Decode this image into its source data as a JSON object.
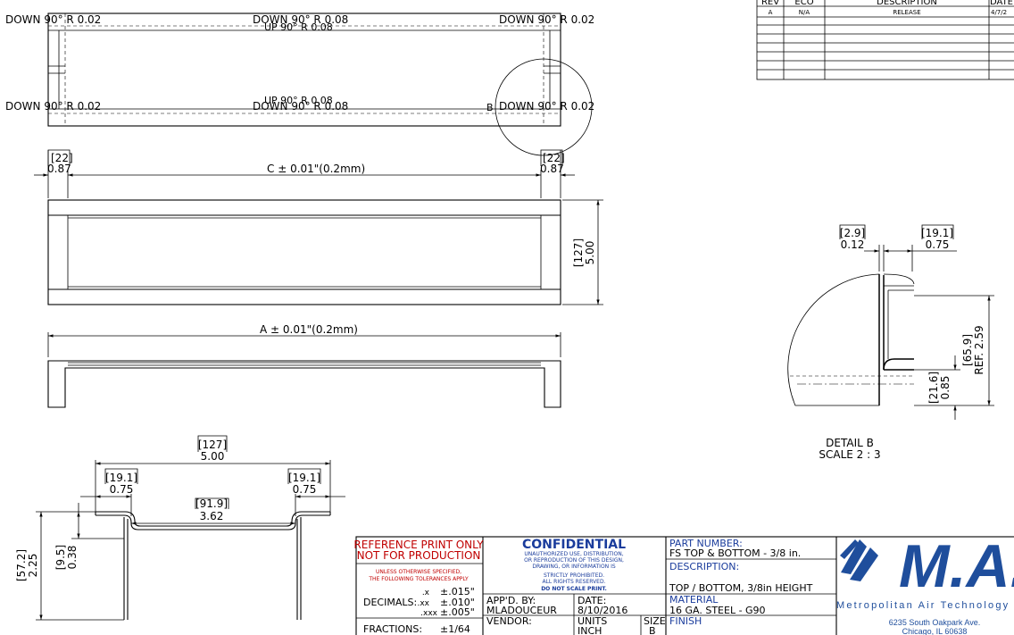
{
  "flat_pattern": {
    "bend_labels": {
      "top_left": "DOWN  90°  R 0.02",
      "top_center": "DOWN  90°  R 0.08",
      "top_center_overlap": "UP  90°  R 0.08",
      "top_right": "DOWN  90°  R 0.02",
      "bottom_left": "DOWN  90°  R 0.02",
      "bottom_center_overlap": "UP  90°  R 0.08",
      "bottom_center": "DOWN  90°  R 0.08",
      "bottom_right": "DOWN  90°  R 0.02"
    },
    "detail_marker": "B"
  },
  "top_view": {
    "left_flange_mm": "[22]",
    "left_flange_in": "0.87",
    "right_flange_mm": "[22]",
    "right_flange_in": "0.87",
    "length_dim": "C ± 0.01\"(0.2mm)",
    "width_mm": "[127]",
    "width_in": "5.00"
  },
  "front_view": {
    "length_dim": "A ± 0.01\"(0.2mm)"
  },
  "section_view": {
    "overall_mm": "[127]",
    "overall_in": "5.00",
    "left_mm": "[19.1]",
    "left_in": "0.75",
    "right_mm": "[19.1]",
    "right_in": "0.75",
    "center_mm": "[91.9]",
    "center_in": "3.62",
    "height_mm": "[57.2]",
    "height_in": "2.25",
    "lip_mm": "[9.5]",
    "lip_in": "0.38"
  },
  "detail_b": {
    "gap_mm": "[2.9]",
    "gap_in": "0.12",
    "flange_mm": "[19.1]",
    "flange_in": "0.75",
    "ref_height_mm": "[65.9]",
    "ref_height_in": "REF. 2.59",
    "low_mm": "[21.6]",
    "low_in": "0.85",
    "title": "DETAIL B",
    "scale": "SCALE 2 : 3"
  },
  "revision_table": {
    "headers": [
      "REV",
      "ECO",
      "DESCRIPTION",
      "DATE"
    ],
    "rows": [
      [
        "A",
        "N/A",
        "RELEASE",
        "4/7/2"
      ]
    ]
  },
  "title_block": {
    "ref_line1": "REFERENCE PRINT ONLY",
    "ref_line2": "NOT FOR PRODUCTION",
    "tol_line1": "UNLESS OTHERWISE SPECIFIED,",
    "tol_line2": "THE FOLLOWING TOLERANCES APPLY",
    "decimals_label": "DECIMALS:",
    "dec_x": ".x",
    "dec_xx": ".xx",
    "dec_xxx": ".xxx",
    "tol_x": "±.015\"",
    "tol_xx": "±.010\"",
    "tol_xxx": "±.005\"",
    "fractions_label": "FRACTIONS:",
    "fractions_val": "±1/64",
    "confidential": "CONFIDENTIAL",
    "conf_l1": "UNAUTHORIZED USE, DISTRIBUTION,",
    "conf_l2": "OR REPRODUCTION OF THIS DESIGN,",
    "conf_l3": "DRAWING, OR INFORMATION IS",
    "conf_l4": "STRICTLY PROHIBITED.",
    "conf_l5": "ALL RIGHTS RESERVED.",
    "conf_l6": "DO NOT SCALE PRINT.",
    "appd_label": "APP'D. BY:",
    "appd_val": "MLADOUCEUR",
    "date_label": "DATE:",
    "date_val": "8/10/2016",
    "vendor_label": "VENDOR:",
    "units_label": "UNITS",
    "units_val": "INCH",
    "size_label": "SIZE",
    "size_val": "B",
    "part_label": "PART NUMBER:",
    "part_val": "FS TOP & BOTTOM - 3/8 in.",
    "desc_label": "DESCRIPTION:",
    "desc_val": "TOP / BOTTOM, 3/8in HEIGHT",
    "material_label": "MATERIAL",
    "material_val": "16 GA. STEEL - G90",
    "finish_label": "FINISH",
    "logo_text": "M.A.T",
    "company_name": "Metropolitan Air Technology",
    "address1": "6235 South Oakpark Ave.",
    "address2": "Chicago, IL 60638",
    "brand_blue": "#1f4e9c",
    "stamp_red": "#c00000"
  }
}
